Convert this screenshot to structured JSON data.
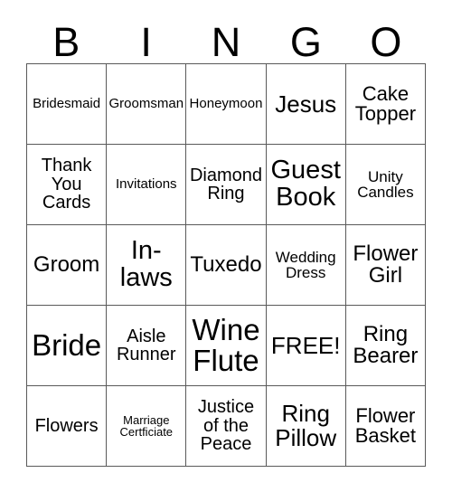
{
  "card": {
    "title": "BINGO",
    "header_letters": [
      "B",
      "I",
      "N",
      "G",
      "O"
    ],
    "free_space_label": "FREE!",
    "colors": {
      "background": "#ffffff",
      "text": "#000000",
      "grid_line": "#5a5a5a"
    },
    "rows": [
      [
        {
          "label": "Bridesmaid",
          "size": "xs"
        },
        {
          "label": "Groomsman",
          "size": "xs"
        },
        {
          "label": "Honeymoon",
          "size": "xs"
        },
        {
          "label": "Jesus",
          "size": "xl"
        },
        {
          "label": "Cake\nTopper",
          "size": "ml"
        }
      ],
      [
        {
          "label": "Thank\nYou\nCards",
          "size": "m"
        },
        {
          "label": "Invitations",
          "size": "xs"
        },
        {
          "label": "Diamond\nRing",
          "size": "m"
        },
        {
          "label": "Guest\nBook",
          "size": "xxl"
        },
        {
          "label": "Unity\nCandles",
          "size": "s"
        }
      ],
      [
        {
          "label": "Groom",
          "size": "l"
        },
        {
          "label": "In-\nlaws",
          "size": "xxl"
        },
        {
          "label": "Tuxedo",
          "size": "l"
        },
        {
          "label": "Wedding\nDress",
          "size": "s"
        },
        {
          "label": "Flower\nGirl",
          "size": "l"
        }
      ],
      [
        {
          "label": "Bride",
          "size": "huge"
        },
        {
          "label": "Aisle\nRunner",
          "size": "m"
        },
        {
          "label": "Wine\nFlute",
          "size": "huge"
        },
        {
          "label": "FREE!",
          "size": "xl"
        },
        {
          "label": "Ring\nBearer",
          "size": "l"
        }
      ],
      [
        {
          "label": "Flowers",
          "size": "m"
        },
        {
          "label": "Marriage\nCertficiate",
          "size": "xxs"
        },
        {
          "label": "Justice\nof the\nPeace",
          "size": "m"
        },
        {
          "label": "Ring\nPillow",
          "size": "xl"
        },
        {
          "label": "Flower\nBasket",
          "size": "ml"
        }
      ]
    ]
  }
}
